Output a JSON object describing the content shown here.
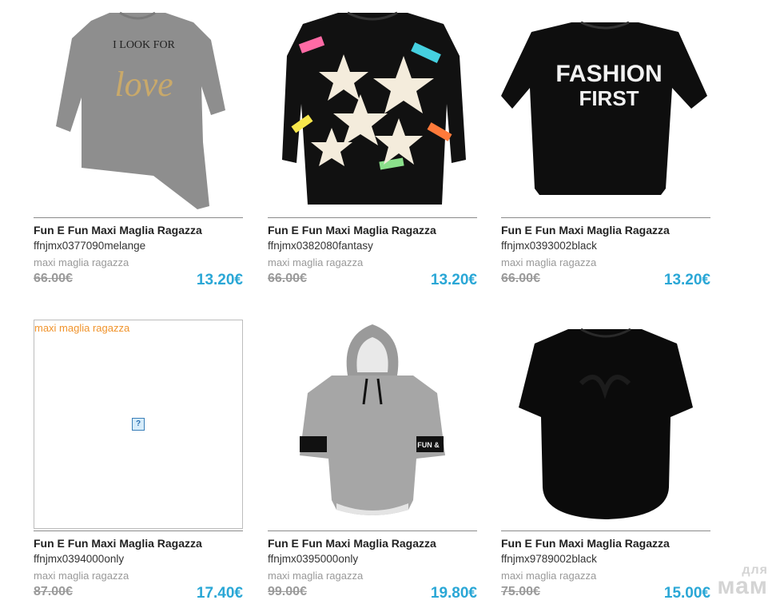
{
  "products": [
    {
      "title": "Fun E Fun Maxi Maglia Ragazza",
      "sku": "ffnjmx0377090melange",
      "category": "maxi maglia ragazza",
      "old_price": "66.00€",
      "price": "13.20€",
      "shirt_text_1": "I LOOK FOR",
      "shirt_text_2": "love"
    },
    {
      "title": "Fun E Fun Maxi Maglia Ragazza",
      "sku": "ffnjmx0382080fantasy",
      "category": "maxi maglia ragazza",
      "old_price": "66.00€",
      "price": "13.20€"
    },
    {
      "title": "Fun E Fun Maxi Maglia Ragazza",
      "sku": "ffnjmx0393002black",
      "category": "maxi maglia ragazza",
      "old_price": "66.00€",
      "price": "13.20€",
      "shirt_text_1": "FASHION",
      "shirt_text_2": "FIRST"
    },
    {
      "title": "Fun E Fun Maxi Maglia Ragazza",
      "sku": "ffnjmx0394000only",
      "category": "maxi maglia ragazza",
      "old_price": "87.00€",
      "price": "17.40€",
      "image_alt": "maxi maglia ragazza",
      "broken_icon": "?"
    },
    {
      "title": "Fun E Fun Maxi Maglia Ragazza",
      "sku": "ffnjmx0395000only",
      "category": "maxi maglia ragazza",
      "old_price": "99.00€",
      "price": "19.80€",
      "sleeve_text": "FUN &"
    },
    {
      "title": "Fun E Fun Maxi Maglia Ragazza",
      "sku": "ffnjmx9789002black",
      "category": "maxi maglia ragazza",
      "old_price": "75.00€",
      "price": "15.00€"
    }
  ],
  "watermark": {
    "line1": "для",
    "line2": "мам"
  },
  "colors": {
    "price": "#2aa7d6",
    "old_price": "#9a9a9a",
    "alt_text": "#f0932b"
  }
}
